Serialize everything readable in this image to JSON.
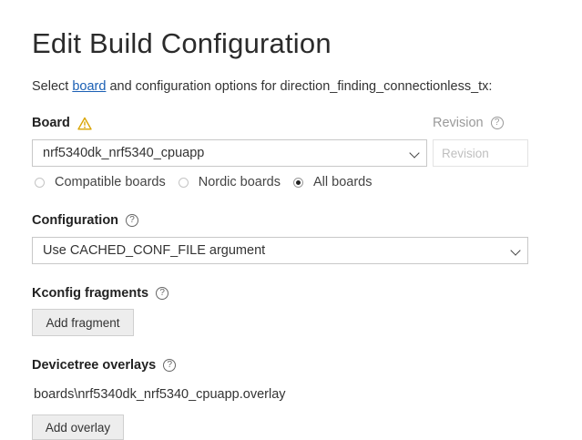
{
  "page": {
    "title": "Edit Build Configuration",
    "subtitle_prefix": "Select ",
    "subtitle_link": "board",
    "subtitle_suffix": " and configuration options for direction_finding_connectionless_tx:"
  },
  "board": {
    "label": "Board",
    "warning_icon": "warning-icon",
    "selected": "nrf5340dk_nrf5340_cpuapp"
  },
  "revision": {
    "label": "Revision",
    "placeholder": "Revision"
  },
  "board_filter": {
    "options": [
      {
        "label": "Compatible boards",
        "checked": false
      },
      {
        "label": "Nordic boards",
        "checked": false
      },
      {
        "label": "All boards",
        "checked": true
      }
    ]
  },
  "configuration": {
    "label": "Configuration",
    "selected": "Use CACHED_CONF_FILE argument"
  },
  "kconfig": {
    "label": "Kconfig fragments",
    "button": "Add fragment"
  },
  "devicetree": {
    "label": "Devicetree overlays",
    "overlay_path": "boards\\nrf5340dk_nrf5340_cpuapp.overlay",
    "button": "Add overlay"
  },
  "colors": {
    "link": "#1a5fb4",
    "warning": "#d9a400",
    "button_bg": "#ededed"
  }
}
